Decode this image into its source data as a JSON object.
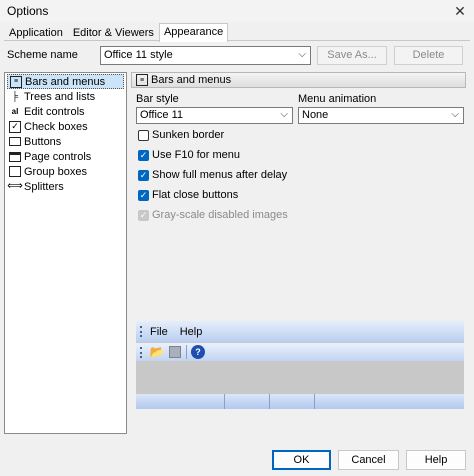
{
  "window": {
    "title": "Options"
  },
  "tabs": [
    {
      "label": "Application"
    },
    {
      "label": "Editor & Viewers"
    },
    {
      "label": "Appearance"
    }
  ],
  "scheme": {
    "label": "Scheme name",
    "value": "Office 11 style",
    "save_as": "Save As...",
    "delete": "Delete"
  },
  "pages": [
    {
      "label": "Bars and menus",
      "icon": "bars-icon"
    },
    {
      "label": "Trees and lists",
      "icon": "tree-icon"
    },
    {
      "label": "Edit controls",
      "icon": "edit-icon"
    },
    {
      "label": "Check boxes",
      "icon": "checkbox-icon"
    },
    {
      "label": "Buttons",
      "icon": "button-icon"
    },
    {
      "label": "Page controls",
      "icon": "page-control-icon"
    },
    {
      "label": "Group boxes",
      "icon": "groupbox-icon"
    },
    {
      "label": "Splitters",
      "icon": "splitter-icon"
    }
  ],
  "section": {
    "title": "Bars and menus",
    "bar_style_label": "Bar style",
    "bar_style_value": "Office 11",
    "menu_animation_label": "Menu animation",
    "menu_animation_value": "None",
    "checks": [
      {
        "label": "Sunken border",
        "checked": false,
        "enabled": true
      },
      {
        "label": "Use F10 for menu",
        "checked": true,
        "enabled": true
      },
      {
        "label": "Show full menus after delay",
        "checked": true,
        "enabled": true
      },
      {
        "label": "Flat close buttons",
        "checked": true,
        "enabled": true
      },
      {
        "label": "Gray-scale disabled images",
        "checked": true,
        "enabled": false
      }
    ]
  },
  "preview": {
    "menus": [
      "File",
      "Help"
    ]
  },
  "footer": {
    "ok": "OK",
    "cancel": "Cancel",
    "help": "Help"
  },
  "colors": {
    "accent": "#0067c0",
    "selection": "#cce4f7"
  }
}
